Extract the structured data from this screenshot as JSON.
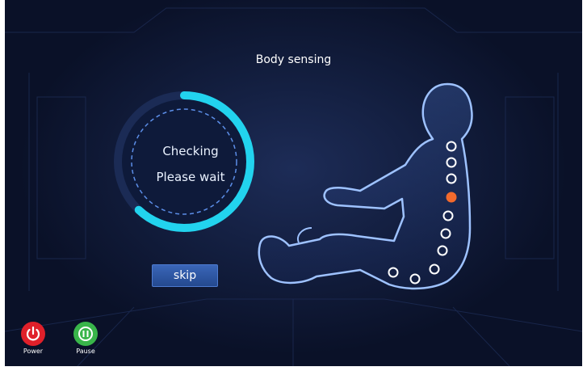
{
  "screen": {
    "title": "Body sensing",
    "status_line_1": "Checking",
    "status_line_2": "Please wait",
    "skip_label": "skip",
    "progress_fraction": 0.62
  },
  "controls": {
    "power_label": "Power",
    "pause_label": "Pause"
  },
  "body_map": {
    "acupoints_total": 10,
    "active_point_index": 3
  },
  "colors": {
    "progress": "#22d3ee",
    "active_point": "#f26a2d",
    "power": "#e0202a",
    "pause": "#39b54a"
  }
}
